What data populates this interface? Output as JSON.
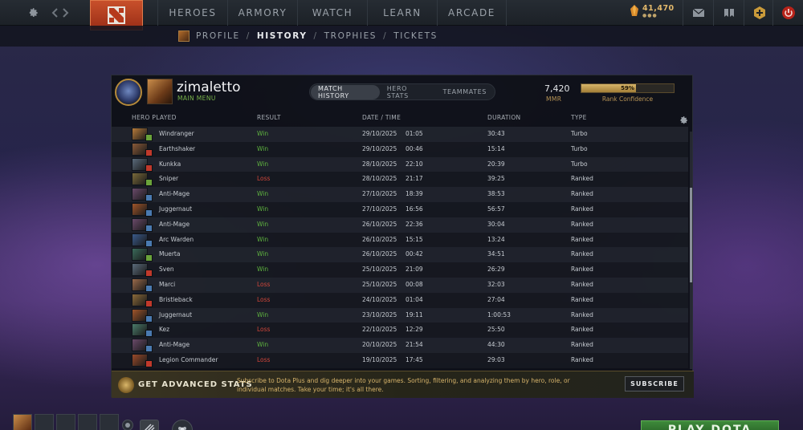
{
  "topbar": {
    "nav": [
      "HEROES",
      "ARMORY",
      "WATCH",
      "LEARN",
      "ARCADE"
    ],
    "gold": "41,470"
  },
  "subnav": {
    "items": [
      "PROFILE",
      "HISTORY",
      "TROPHIES",
      "TICKETS"
    ],
    "active": "HISTORY",
    "separator": "/"
  },
  "profile": {
    "username": "zimaletto",
    "status": "MAIN MENU",
    "tabs": [
      "MATCH HISTORY",
      "HERO STATS",
      "TEAMMATES"
    ],
    "active_tab": "MATCH HISTORY",
    "mmr": "7,420",
    "mmr_label": "MMR",
    "rank_confidence": "59%",
    "rank_confidence_value": 59,
    "rank_confidence_label": "Rank Confidence"
  },
  "table": {
    "headers": [
      "HERO PLAYED",
      "RESULT",
      "DATE / TIME",
      "DURATION",
      "TYPE"
    ],
    "rows": [
      {
        "hero": "Windranger",
        "result": "Win",
        "date": "29/10/2025",
        "time": "01:05",
        "duration": "30:43",
        "type": "Turbo",
        "hero_color": "#b57a3a",
        "badge_color": "#6aa33a"
      },
      {
        "hero": "Earthshaker",
        "result": "Win",
        "date": "29/10/2025",
        "time": "00:46",
        "duration": "15:14",
        "type": "Turbo",
        "hero_color": "#8a5a38",
        "badge_color": "#c0392b"
      },
      {
        "hero": "Kunkka",
        "result": "Win",
        "date": "28/10/2025",
        "time": "22:10",
        "duration": "20:39",
        "type": "Turbo",
        "hero_color": "#5a6a7a",
        "badge_color": "#c0392b"
      },
      {
        "hero": "Sniper",
        "result": "Loss",
        "date": "28/10/2025",
        "time": "21:17",
        "duration": "39:25",
        "type": "Ranked",
        "hero_color": "#7a6a3a",
        "badge_color": "#6aa33a"
      },
      {
        "hero": "Anti-Mage",
        "result": "Win",
        "date": "27/10/2025",
        "time": "18:39",
        "duration": "38:53",
        "type": "Ranked",
        "hero_color": "#6a4a6a",
        "badge_color": "#4a7ab0"
      },
      {
        "hero": "Juggernaut",
        "result": "Win",
        "date": "27/10/2025",
        "time": "16:56",
        "duration": "56:57",
        "type": "Ranked",
        "hero_color": "#a0552a",
        "badge_color": "#4a7ab0"
      },
      {
        "hero": "Anti-Mage",
        "result": "Win",
        "date": "26/10/2025",
        "time": "22:36",
        "duration": "30:04",
        "type": "Ranked",
        "hero_color": "#6a4a6a",
        "badge_color": "#4a7ab0"
      },
      {
        "hero": "Arc Warden",
        "result": "Win",
        "date": "26/10/2025",
        "time": "15:15",
        "duration": "13:24",
        "type": "Ranked",
        "hero_color": "#3a5a8a",
        "badge_color": "#4a7ab0"
      },
      {
        "hero": "Muerta",
        "result": "Win",
        "date": "26/10/2025",
        "time": "00:42",
        "duration": "34:51",
        "type": "Ranked",
        "hero_color": "#3a6a5a",
        "badge_color": "#6aa33a"
      },
      {
        "hero": "Sven",
        "result": "Win",
        "date": "25/10/2025",
        "time": "21:09",
        "duration": "26:29",
        "type": "Ranked",
        "hero_color": "#5a6a7a",
        "badge_color": "#c0392b"
      },
      {
        "hero": "Marci",
        "result": "Loss",
        "date": "25/10/2025",
        "time": "00:08",
        "duration": "32:03",
        "type": "Ranked",
        "hero_color": "#9a6a4a",
        "badge_color": "#4a7ab0"
      },
      {
        "hero": "Bristleback",
        "result": "Loss",
        "date": "24/10/2025",
        "time": "01:04",
        "duration": "27:04",
        "type": "Ranked",
        "hero_color": "#8a6a3a",
        "badge_color": "#c0392b"
      },
      {
        "hero": "Juggernaut",
        "result": "Win",
        "date": "23/10/2025",
        "time": "19:11",
        "duration": "1:00:53",
        "type": "Ranked",
        "hero_color": "#a0552a",
        "badge_color": "#4a7ab0"
      },
      {
        "hero": "Kez",
        "result": "Loss",
        "date": "22/10/2025",
        "time": "12:29",
        "duration": "25:50",
        "type": "Ranked",
        "hero_color": "#4a7a6a",
        "badge_color": "#4a7ab0"
      },
      {
        "hero": "Anti-Mage",
        "result": "Win",
        "date": "20/10/2025",
        "time": "21:54",
        "duration": "44:30",
        "type": "Ranked",
        "hero_color": "#6a4a6a",
        "badge_color": "#4a7ab0"
      },
      {
        "hero": "Legion Commander",
        "result": "Loss",
        "date": "19/10/2025",
        "time": "17:45",
        "duration": "29:03",
        "type": "Ranked",
        "hero_color": "#9a4a2a",
        "badge_color": "#c0392b"
      }
    ]
  },
  "advanced": {
    "title": "GET ADVANCED STATS",
    "description": "Subscribe to Dota Plus and dig deeper into your games. Sorting, filtering, and analyzing them by hero, role, or individual matches. Take your time; it's all there.",
    "button": "SUBSCRIBE"
  },
  "bottom": {
    "play": "PLAY DOTA"
  },
  "colors": {
    "win": "#5fb53f",
    "loss": "#d0463a",
    "gold": "#d6b36a",
    "accent_orange": "#c8502b"
  }
}
